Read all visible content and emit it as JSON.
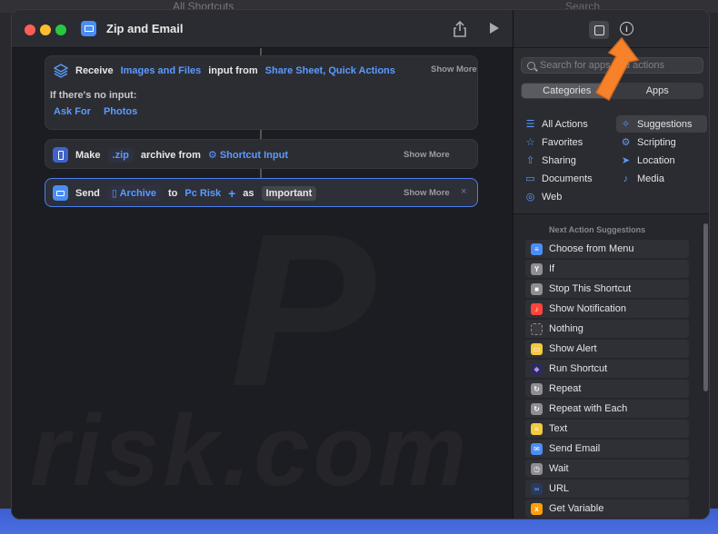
{
  "background": {
    "ghost_title": "All Shortcuts",
    "ghost_search": "Search"
  },
  "window": {
    "title": "Zip and Email"
  },
  "actions": {
    "receive": {
      "verb": "Receive",
      "types": "Images and Files",
      "input_from": "input from",
      "sources": "Share Sheet, Quick Actions",
      "show_more": "Show More",
      "no_input_label": "If there's no input:",
      "ask_for": "Ask For",
      "photos": "Photos"
    },
    "make": {
      "verb": "Make",
      "format": ".zip",
      "archive_from": "archive from",
      "source": "Shortcut Input",
      "show_more": "Show More"
    },
    "send": {
      "verb": "Send",
      "item": "Archive",
      "to": "to",
      "recipient": "Pc Risk",
      "plus": "+",
      "as": "as",
      "subject": "Important",
      "show_more": "Show More",
      "close": "×"
    }
  },
  "sidebar": {
    "search_placeholder": "Search for apps and actions",
    "segments": [
      "Categories",
      "Apps"
    ],
    "categories": [
      {
        "label": "All Actions",
        "icon": "list-icon"
      },
      {
        "label": "Suggestions",
        "icon": "sparkle-icon"
      },
      {
        "label": "Favorites",
        "icon": "star-icon"
      },
      {
        "label": "Scripting",
        "icon": "scripting-icon"
      },
      {
        "label": "Sharing",
        "icon": "share-icon"
      },
      {
        "label": "Location",
        "icon": "location-icon"
      },
      {
        "label": "Documents",
        "icon": "document-icon"
      },
      {
        "label": "Media",
        "icon": "music-icon"
      },
      {
        "label": "Web",
        "icon": "compass-icon"
      }
    ],
    "suggestions_header": "Next Action Suggestions",
    "suggestions": [
      {
        "label": "Choose from Menu",
        "color": "#4a8ef5",
        "icon": "menu-icon"
      },
      {
        "label": "If",
        "color": "#8e8e93",
        "icon": "branch-icon"
      },
      {
        "label": "Stop This Shortcut",
        "color": "#8e8e93",
        "icon": "stop-icon"
      },
      {
        "label": "Show Notification",
        "color": "#ff453a",
        "icon": "bell-icon"
      },
      {
        "label": "Nothing",
        "color": "#3a3a3f",
        "icon": "empty-icon"
      },
      {
        "label": "Show Alert",
        "color": "#f5c842",
        "icon": "alert-icon"
      },
      {
        "label": "Run Shortcut",
        "color": "#2c2c5a",
        "icon": "layers-icon"
      },
      {
        "label": "Repeat",
        "color": "#8e8e93",
        "icon": "repeat-icon"
      },
      {
        "label": "Repeat with Each",
        "color": "#8e8e93",
        "icon": "repeat-each-icon"
      },
      {
        "label": "Text",
        "color": "#f5c842",
        "icon": "text-icon"
      },
      {
        "label": "Send Email",
        "color": "#4a8ef5",
        "icon": "mail-icon"
      },
      {
        "label": "Wait",
        "color": "#8e8e93",
        "icon": "clock-icon"
      },
      {
        "label": "URL",
        "color": "#2c3a5a",
        "icon": "link-icon"
      },
      {
        "label": "Get Variable",
        "color": "#ff9f0a",
        "icon": "variable-icon"
      }
    ]
  },
  "watermark": "risk.com"
}
